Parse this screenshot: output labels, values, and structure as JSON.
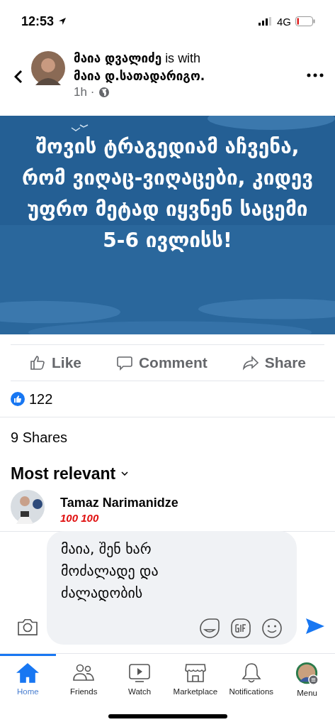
{
  "status_bar": {
    "time": "12:53",
    "network": "4G"
  },
  "post": {
    "author": "მაია დვალიძე",
    "with_text": "is with",
    "tagged": "მაია დ.სათადარიგო.",
    "time": "1h ·",
    "image_text": "შოვის ტრაგედიამ აჩვენა, რომ ვიღაც-ვიღაცები, კიდევ უფრო მეტად იყვნენ საცემი 5-6 ივლისს!"
  },
  "actions": [
    {
      "kind": "like",
      "label": "Like"
    },
    {
      "kind": "comment",
      "label": "Comment"
    },
    {
      "kind": "share",
      "label": "Share"
    }
  ],
  "reactions_count": "122",
  "shares": "9 Shares",
  "sort": "Most relevant",
  "comments": [
    {
      "author": "Tamaz Narimanidze",
      "text": "100 100"
    }
  ],
  "composer": {
    "value": "მაია, შენ ხარ მოძალადე და ძალადობის"
  },
  "tabs": [
    {
      "kind": "home",
      "label": "Home",
      "selected": true
    },
    {
      "kind": "friends",
      "label": "Friends",
      "selected": false
    },
    {
      "kind": "watch",
      "label": "Watch",
      "selected": false
    },
    {
      "kind": "marketplace",
      "label": "Marketplace",
      "selected": false
    },
    {
      "kind": "notifications",
      "label": "Notifications",
      "selected": false
    },
    {
      "kind": "menu",
      "label": "Menu",
      "selected": false
    }
  ]
}
